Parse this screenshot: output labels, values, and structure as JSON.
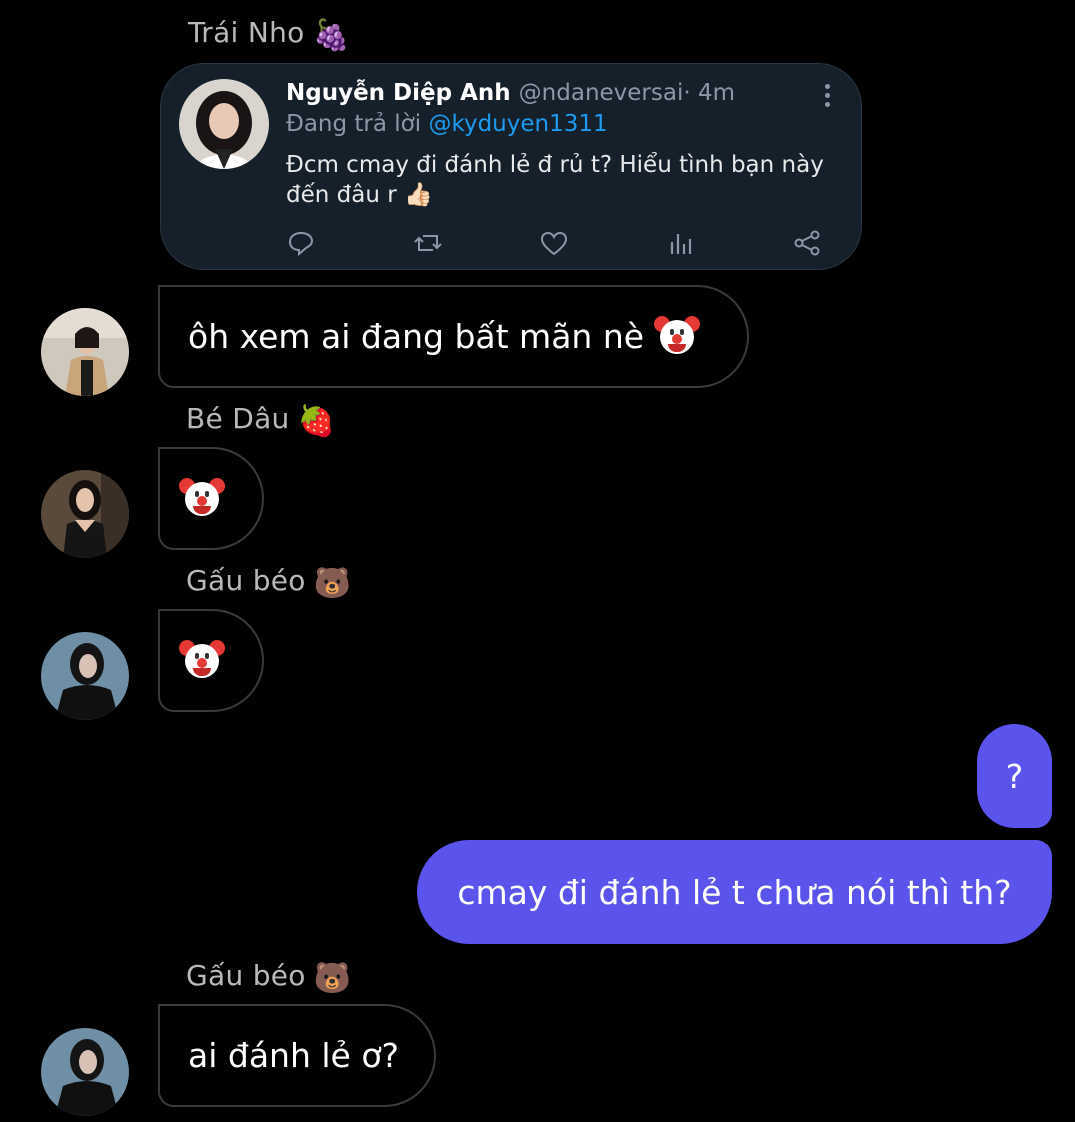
{
  "tweet": {
    "author_name": "Nguyễn Diệp Anh",
    "author_handle": "@ndaneversai",
    "time": "· 4m",
    "replying_to_label": "Đang trả lời",
    "replying_to_handle": "@kyduyen1311",
    "text": "Đcm cmay đi đánh lẻ đ rủ t? Hiểu tình bạn này đến đâu r 👍🏻"
  },
  "messages": [
    {
      "sender": "Trái Nho",
      "sender_emoji": "🍇"
    },
    {
      "text": "ôh xem ai đang bất mãn nè"
    },
    {
      "sender": "Bé Dâu",
      "sender_emoji": "🍓"
    },
    {
      "sender": "Gấu béo",
      "sender_emoji": "🐻"
    },
    {
      "text": "?"
    },
    {
      "text": "cmay đi đánh lẻ t chưa nói thì th?"
    },
    {
      "sender": "Gấu béo",
      "sender_emoji": "🐻"
    },
    {
      "text": "ai đánh lẻ ơ?"
    }
  ],
  "icons": [
    "reply-icon",
    "retweet-icon",
    "like-icon",
    "views-icon",
    "share-icon",
    "more-options-icon",
    "clown-emoji"
  ],
  "colors": {
    "outgoing_bubble": "#5a53ec",
    "tweet_card_bg": "#15202b",
    "mention": "#1d9bf0"
  }
}
